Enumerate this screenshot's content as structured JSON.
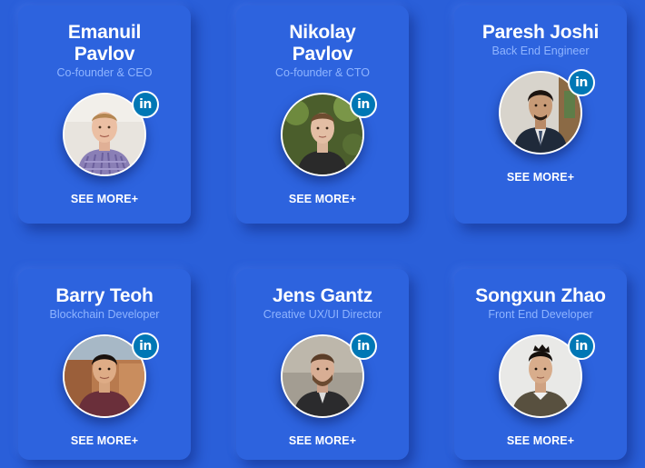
{
  "team": [
    {
      "name_line1": "Emanuil",
      "name_line2": "Pavlov",
      "role": "Co-founder & CEO",
      "linkedin_label": "in",
      "cta": "SEE MORE+"
    },
    {
      "name_line1": "Nikolay",
      "name_line2": "Pavlov",
      "role": "Co-founder & CTO",
      "linkedin_label": "in",
      "cta": "SEE MORE+"
    },
    {
      "name_line1": "Paresh Joshi",
      "role": "Back End Engineer",
      "linkedin_label": "in",
      "cta": "SEE MORE+"
    },
    {
      "name_line1": "Barry Teoh",
      "role": "Blockchain Developer",
      "linkedin_label": "in",
      "cta": "SEE MORE+"
    },
    {
      "name_line1": "Jens Gantz",
      "role": "Creative UX/UI Director",
      "linkedin_label": "in",
      "cta": "SEE MORE+"
    },
    {
      "name_line1": "Songxun Zhao",
      "role": "Front End Developer",
      "linkedin_label": "in",
      "cta": "SEE MORE+"
    }
  ],
  "colors": {
    "background": "#2a5fd9",
    "card": "#2d63de",
    "role_text": "#8fb4ff",
    "linkedin": "#0077b5"
  }
}
